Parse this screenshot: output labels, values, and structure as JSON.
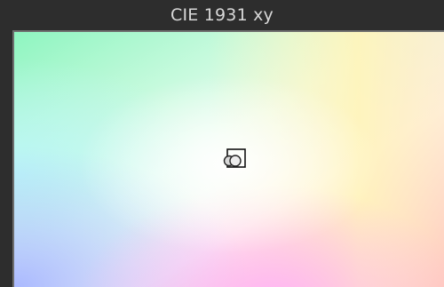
{
  "window": {
    "title": "CIE 1931 xy"
  },
  "colors": {
    "background": "#2d2d2d",
    "title_text": "#d8d8d8",
    "frame_border": "#6e6e6e",
    "gamut_green": "#8ef5c0",
    "gamut_yellow": "#fff4b8",
    "gamut_cyan": "#b9f6f7",
    "gamut_white": "#ffffff",
    "gamut_pink": "#ff9fb9",
    "gamut_magenta": "#ffb6f4",
    "gamut_blue": "#aab9ff"
  },
  "markers": {
    "white_point": "white-point-marker",
    "target_point": "target-point-marker"
  }
}
